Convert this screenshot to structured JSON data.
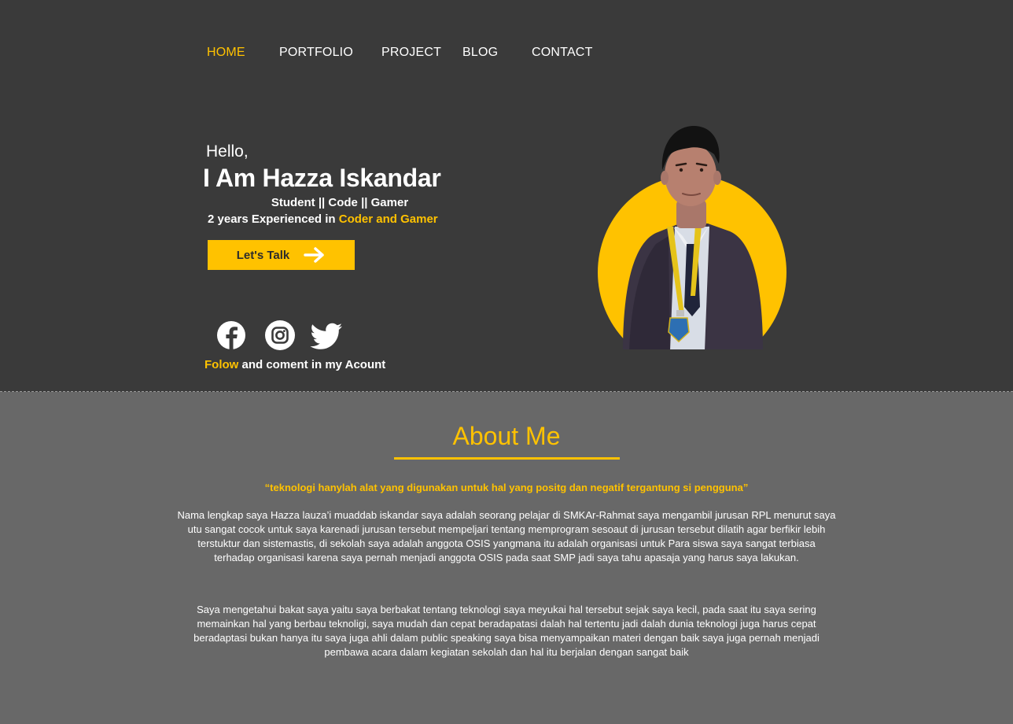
{
  "nav": {
    "items": [
      {
        "label": "HOME",
        "active": true
      },
      {
        "label": "PORTFOLIO",
        "active": false
      },
      {
        "label": "PROJECT",
        "active": false
      },
      {
        "label": "BLOG",
        "active": false
      },
      {
        "label": "CONTACT",
        "active": false
      }
    ]
  },
  "hero": {
    "greeting": "Hello,",
    "name": "I Am Hazza Iskandar",
    "roles": "Student || Code || Gamer",
    "experience_prefix": "2 years Experienced in ",
    "experience_highlight": "Coder and Gamer",
    "cta_label": "Let's Talk",
    "cta_icon": "arrow-right-icon",
    "social_icons": [
      "facebook-icon",
      "instagram-icon",
      "twitter-icon"
    ],
    "follow_highlight": "Folow",
    "follow_rest": " and coment in my Acount",
    "portrait": "profile-photo"
  },
  "about": {
    "title": "About Me",
    "quote": "“teknologi hanylah alat yang digunakan untuk hal yang positg dan negatif tergantung si pengguna”",
    "paragraph1": "Nama lengkap saya Hazza lauza’i muaddab iskandar saya adalah seorang pelajar di SMKAr-Rahmat saya mengambil jurusan RPL menurut saya utu sangat cocok untuk saya karenadi jurusan tersebut mempeljari tentang memprogram sesoaut di jurusan tersebut dilatih agar berfikir lebih terstuktur dan sistemastis, di sekolah saya adalah anggota OSIS yangmana itu adalah organisasi untuk Para siswa saya sangat terbiasa terhadap organisasi karena saya pernah menjadi anggota OSIS pada saat SMP jadi saya tahu apasaja yang harus saya lakukan.",
    "paragraph2": "Saya mengetahui bakat saya yaitu saya berbakat tentang teknologi saya meyukai hal tersebut sejak saya kecil, pada saat itu saya sering memainkan hal yang berbau teknoligi, saya mudah dan cepat beradapatasi dalah hal tertentu jadi dalah dunia teknologi juga harus cepat beradaptasi bukan hanya itu saya juga ahli dalam public speaking saya bisa menyampaikan materi dengan baik saya juga pernah menjadi pembawa acara dalam kegiatan sekolah dan hal itu berjalan dengan sangat baik"
  },
  "colors": {
    "accent": "#ffc200",
    "hero_bg": "#3a3a3a",
    "about_bg": "#686868",
    "text": "#ffffff"
  }
}
